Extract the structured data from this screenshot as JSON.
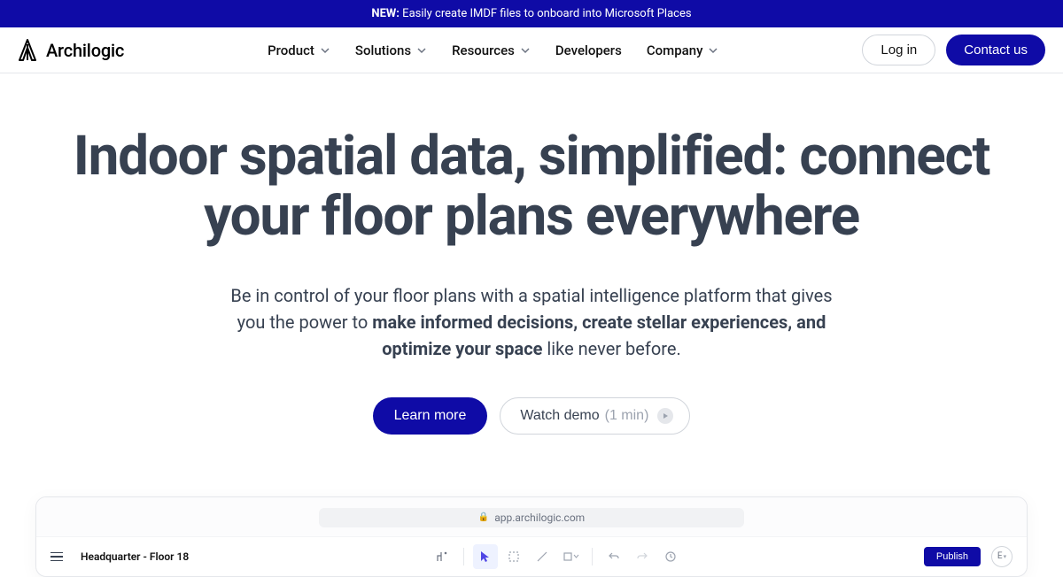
{
  "announcement": {
    "prefix": "NEW:",
    "text": " Easily create IMDF files to onboard into Microsoft Places"
  },
  "brand": "Archilogic",
  "nav": {
    "product": "Product",
    "solutions": "Solutions",
    "resources": "Resources",
    "developers": "Developers",
    "company": "Company"
  },
  "actions": {
    "login": "Log in",
    "contact": "Contact us"
  },
  "hero": {
    "title": "Indoor spatial data, simplified: connect your floor plans everywhere",
    "sub_prefix": "Be in control of your floor plans with a spatial intelligence platform that gives you the power to ",
    "sub_bold": "make informed decisions, create stellar experiences, and optimize your space",
    "sub_suffix": " like never before.",
    "cta_primary": "Learn more",
    "cta_secondary": "Watch demo",
    "cta_secondary_hint": "(1 min)"
  },
  "app": {
    "url": "app.archilogic.com",
    "floor_name": "Headquarter - Floor 18",
    "publish": "Publish",
    "avatar_initial": "E"
  }
}
